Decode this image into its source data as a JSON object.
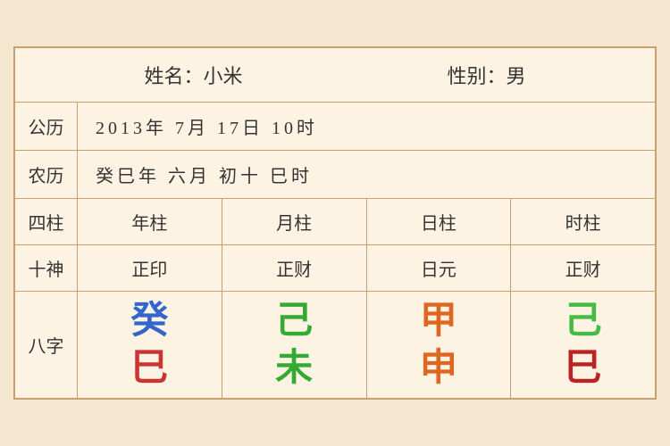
{
  "header": {
    "name_label": "姓名：小米",
    "gender_label": "性别：男"
  },
  "solar": {
    "label": "公历",
    "value": "2013年 7月 17日 10时"
  },
  "lunar": {
    "label": "农历",
    "value": "癸巳年 六月 初十 巳时"
  },
  "pillars": {
    "label": "四柱",
    "columns": [
      "年柱",
      "月柱",
      "日柱",
      "时柱"
    ]
  },
  "shishen": {
    "label": "十神",
    "columns": [
      "正印",
      "正财",
      "日元",
      "正财"
    ]
  },
  "bazhi": {
    "label": "八字",
    "columns": [
      {
        "top": "癸",
        "bottom": "巳",
        "top_color": "color-blue",
        "bottom_color": "color-red"
      },
      {
        "top": "己",
        "bottom": "未",
        "top_color": "color-green",
        "bottom_color": "color-green"
      },
      {
        "top": "甲",
        "bottom": "申",
        "top_color": "color-orange",
        "bottom_color": "color-orange"
      },
      {
        "top": "己",
        "bottom": "巳",
        "top_color": "color-green2",
        "bottom_color": "color-darkred"
      }
    ]
  }
}
